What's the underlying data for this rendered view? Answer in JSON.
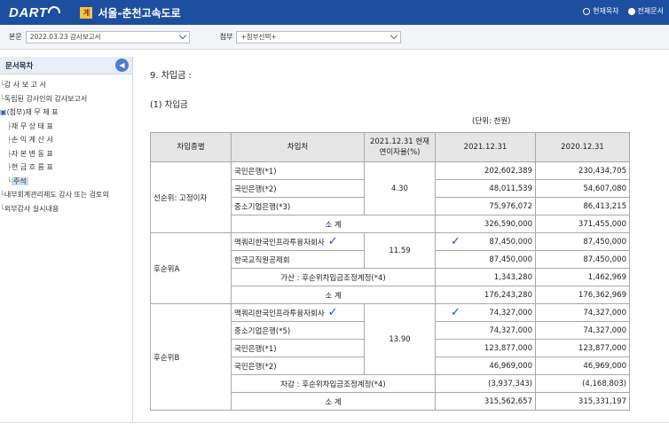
{
  "header": {
    "logo_text": "DART",
    "company_badge": "계",
    "company_name": "서울-춘천고속도로",
    "radio_current": "현재목차",
    "radio_all": "전체문서",
    "bg_color": "#1d4fa0"
  },
  "selectors": {
    "main_label": "본문",
    "main_value": "2022.03.23  감사보고서",
    "attach_label": "첨부",
    "attach_value": "+첨부선택+"
  },
  "sidebar": {
    "title": "문서목차",
    "items": [
      {
        "label": "감 사 보 고 서",
        "prefix": "└"
      },
      {
        "label": "독립된 감사인의 감사보고서",
        "prefix": "└"
      },
      {
        "label": "(첨부)재 무 제 표",
        "prefix": "▣"
      },
      {
        "label": "재 무 상 태 표",
        "prefix": "　├"
      },
      {
        "label": "손 익 계 산 서",
        "prefix": "　├"
      },
      {
        "label": "자 본 변 동 표",
        "prefix": "　├"
      },
      {
        "label": "현 금 흐 름 표",
        "prefix": "　├"
      },
      {
        "label": "주석",
        "prefix": "　└"
      },
      {
        "label": "내부회계관리제도 감사 또는 검토의",
        "prefix": "└"
      },
      {
        "label": "외부감사 실시내용",
        "prefix": "└"
      }
    ]
  },
  "doc": {
    "section_title": "9. 차입금 :",
    "sub_title": "(1) 차입금",
    "unit": "(단위: 천원)",
    "headers": {
      "type": "차입종별",
      "lender": "차입처",
      "rate": "2021.12.31 현재\n연이자율(%)",
      "y2021": "2021.12.31",
      "y2020": "2020.12.31"
    },
    "groups": [
      {
        "type": "선순위: 고정이자",
        "rate": "4.30",
        "rows": [
          {
            "lender": "국민은행(*1)",
            "y2021": "202,602,389",
            "y2020": "230,434,705"
          },
          {
            "lender": "국민은행(*2)",
            "y2021": "48,011,539",
            "y2020": "54,607,080"
          },
          {
            "lender": "중소기업은행(*3)",
            "y2021": "75,976,072",
            "y2020": "86,413,215"
          }
        ],
        "subtotal_label": "소    계",
        "subtotal_2021": "326,590,000",
        "subtotal_2020": "371,455,000"
      },
      {
        "type": "후순위A",
        "rate": "11.59",
        "rows": [
          {
            "lender": "맥쿼리한국인프라투융자회사",
            "y2021": "87,450,000",
            "y2020": "87,450,000",
            "check": "✓"
          },
          {
            "lender": "한국교직원공제회",
            "y2021": "87,450,000",
            "y2020": "87,450,000"
          }
        ],
        "adjust_label": "가산 : 후순위차입금조정계정(*4)",
        "adjust_2021": "1,343,280",
        "adjust_2020": "1,462,969",
        "subtotal_label": "소    계",
        "subtotal_2021": "176,243,280",
        "subtotal_2020": "176,362,969"
      },
      {
        "type": "후순위B",
        "rate": "13.90",
        "rows": [
          {
            "lender": "맥쿼리한국인프라투융자회사",
            "y2021": "74,327,000",
            "y2020": "74,327,000",
            "check": "✓"
          },
          {
            "lender": "중소기업은행(*5)",
            "y2021": "74,327,000",
            "y2020": "74,327,000"
          },
          {
            "lender": "국민은행(*1)",
            "y2021": "123,877,000",
            "y2020": "123,877,000"
          },
          {
            "lender": "국민은행(*2)",
            "y2021": "46,969,000",
            "y2020": "46,969,000"
          }
        ],
        "adjust_label": "차감 : 후순위차입금조정계정(*4)",
        "adjust_2021": "(3,937,343)",
        "adjust_2020": "(4,168,803)",
        "subtotal_label": "소    계",
        "subtotal_2021": "315,562,657",
        "subtotal_2020": "315,331,197"
      }
    ]
  }
}
